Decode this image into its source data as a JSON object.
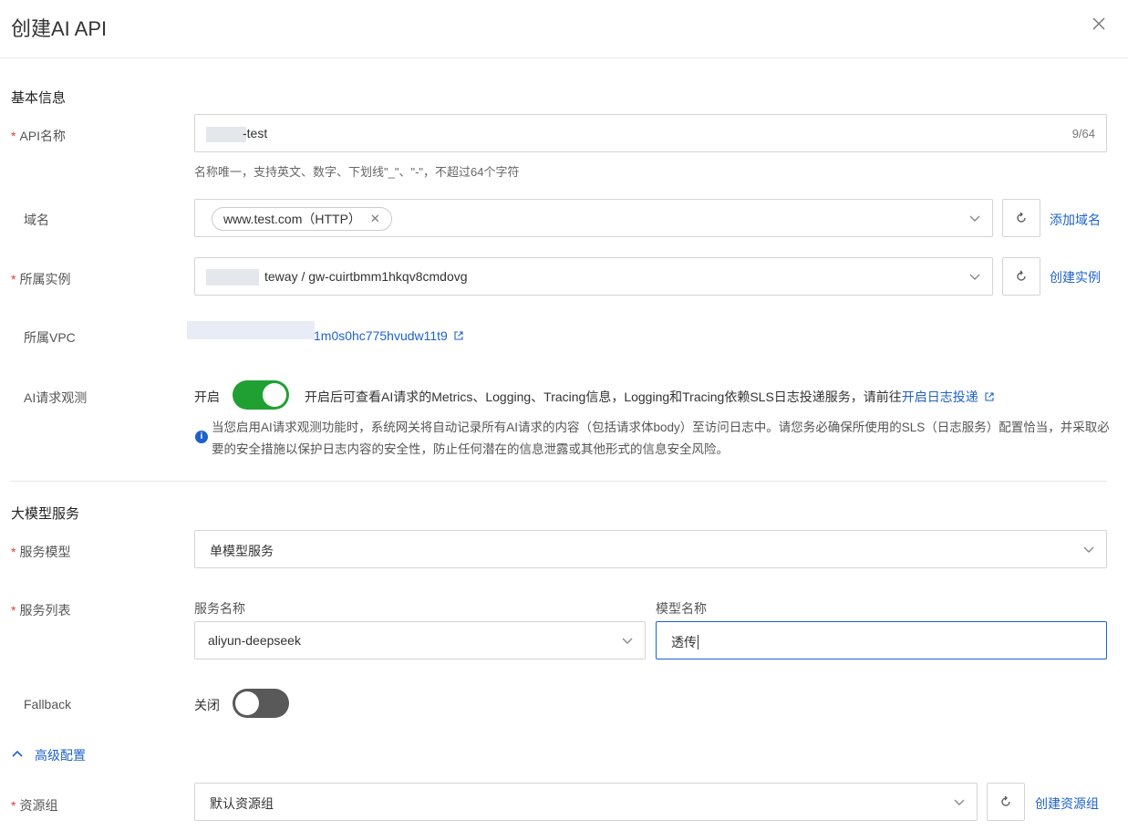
{
  "dialog": {
    "title": "创建AI API"
  },
  "basic": {
    "section_title": "基本信息",
    "api_name": {
      "label": "API名称",
      "value": "-test",
      "count": "9/64",
      "hint": "名称唯一，支持英文、数字、下划线\"_\"、\"-\"，不超过64个字符"
    },
    "domain": {
      "label": "域名",
      "tag": "www.test.com（HTTP）",
      "add_link": "添加域名"
    },
    "instance": {
      "label": "所属实例",
      "value": "teway / gw-cuirtbmm1hkqv8cmdovg",
      "create_link": "创建实例"
    },
    "vpc": {
      "label": "所属VPC",
      "value": "1m0s0hc775hvudw11t9"
    },
    "observe": {
      "label": "AI请求观测",
      "switch_label": "开启",
      "desc": "开启后可查看AI请求的Metrics、Logging、Tracing信息，Logging和Tracing依赖SLS日志投递服务，请前往",
      "link": "开启日志投递",
      "notice": "当您启用AI请求观测功能时，系统网关将自动记录所有AI请求的内容（包括请求体body）至访问日志中。请您务必确保所使用的SLS（日志服务）配置恰当，并采取必要的安全措施以保护日志内容的安全性，防止任何潜在的信息泄露或其他形式的信息安全风险。"
    }
  },
  "model": {
    "section_title": "大模型服务",
    "service_model": {
      "label": "服务模型",
      "value": "单模型服务"
    },
    "service_list": {
      "label": "服务列表",
      "service_name_label": "服务名称",
      "service_name_value": "aliyun-deepseek",
      "model_name_label": "模型名称",
      "model_name_value": "透传"
    },
    "fallback": {
      "label": "Fallback",
      "switch_label": "关闭"
    },
    "advanced": "高级配置",
    "resource_group": {
      "label": "资源组",
      "value": "默认资源组",
      "create_link": "创建资源组"
    }
  },
  "colors": {
    "accent": "#1e62c9",
    "switch_on": "#20a032",
    "switch_off": "#595959",
    "required": "#e0403a"
  },
  "switches": {
    "observe_on": true,
    "fallback_on": false
  }
}
